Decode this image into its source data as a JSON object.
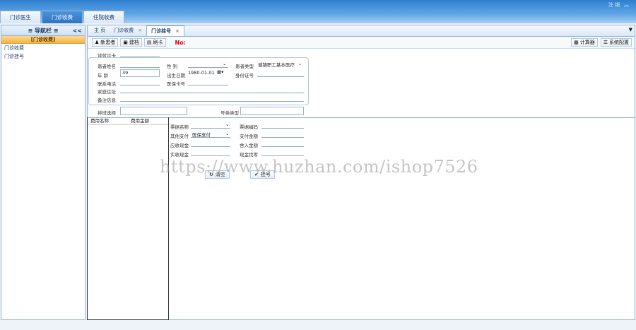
{
  "header": {
    "logout": "注 销",
    "top_tabs": [
      "门诊医生",
      "门诊收费",
      "住院收费"
    ]
  },
  "sidebar": {
    "title": "≡ 导航栏 ≡",
    "collapse": "<<",
    "group": "[门诊收费]",
    "items": [
      "门诊收费",
      "门诊挂号"
    ]
  },
  "tabs": [
    {
      "label": "主 页"
    },
    {
      "label": "门诊收费"
    },
    {
      "label": "门诊挂号"
    }
  ],
  "toolbar": {
    "new_patient": "新患者",
    "create_file": "建档",
    "swipe_card": "刷卡",
    "no_label": "No:",
    "calculator": "计算器",
    "system_config": "系统配置"
  },
  "form": {
    "read_card": "读就诊卡",
    "patient_name": "患者姓名",
    "gender": "性    别",
    "patient_type": "患者类型",
    "patient_type_value": "城镇职工基本医疗",
    "age": "年    龄",
    "age_value": "39",
    "birth_date": "出生日期",
    "birth_date_value": "1980-01-01",
    "id_number": "身份证号",
    "phone": "联系电话",
    "insurance_no": "医保卡号",
    "address": "家庭住址",
    "remark": "备注信息",
    "queue_select": "排班选择",
    "number_type": "号类类型"
  },
  "fee_table": {
    "col_name": "费用名称",
    "col_amount": "费用金额"
  },
  "payment": {
    "bill_name": "票据名称",
    "bill_no": "票据编码",
    "other_pay": "其他支付",
    "other_pay_value": "医保支付",
    "pay_amount": "支付金额",
    "receivable_cash": "应收现金",
    "rounding": "舍入金额",
    "actual_cash": "实收现金",
    "change": "现金找零",
    "clear_btn": "清空",
    "register_btn": "挂号"
  },
  "watermark": "https://www.huzhan.com/ishop7526"
}
